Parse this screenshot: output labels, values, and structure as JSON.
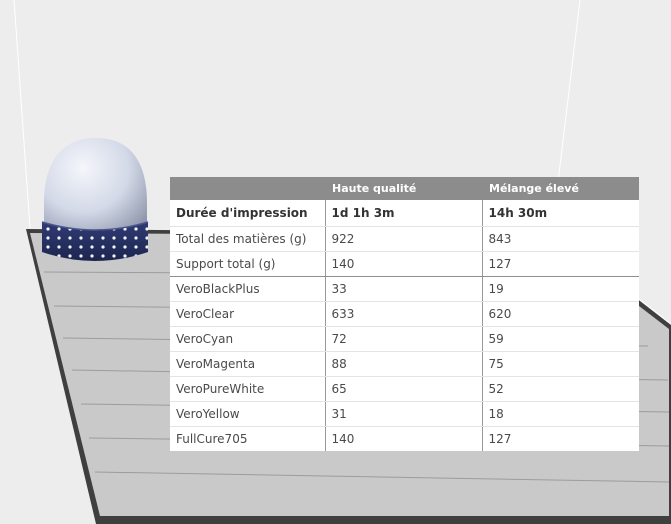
{
  "table": {
    "headers": [
      "",
      "Haute qualité",
      "Mélange élevé"
    ],
    "rows": [
      [
        "Durée d'impression",
        "1d 1h 3m",
        "14h 30m"
      ],
      [
        "Total des matières (g)",
        "922",
        "843"
      ],
      [
        "Support total (g)",
        "140",
        "127"
      ],
      [
        "VeroBlackPlus",
        "33",
        "19"
      ],
      [
        "VeroClear",
        "633",
        "620"
      ],
      [
        "VeroCyan",
        "72",
        "59"
      ],
      [
        "VeroMagenta",
        "88",
        "75"
      ],
      [
        "VeroPureWhite",
        "65",
        "52"
      ],
      [
        "VeroYellow",
        "31",
        "18"
      ],
      [
        "FullCure705",
        "140",
        "127"
      ]
    ]
  },
  "colors": {
    "background": "#ededed",
    "tray": "#c9c9c9",
    "tray_edge": "#4d4d4d",
    "header": "#8c8c8c",
    "model_body": "#d6dbe8",
    "model_band": "#2a3566"
  }
}
